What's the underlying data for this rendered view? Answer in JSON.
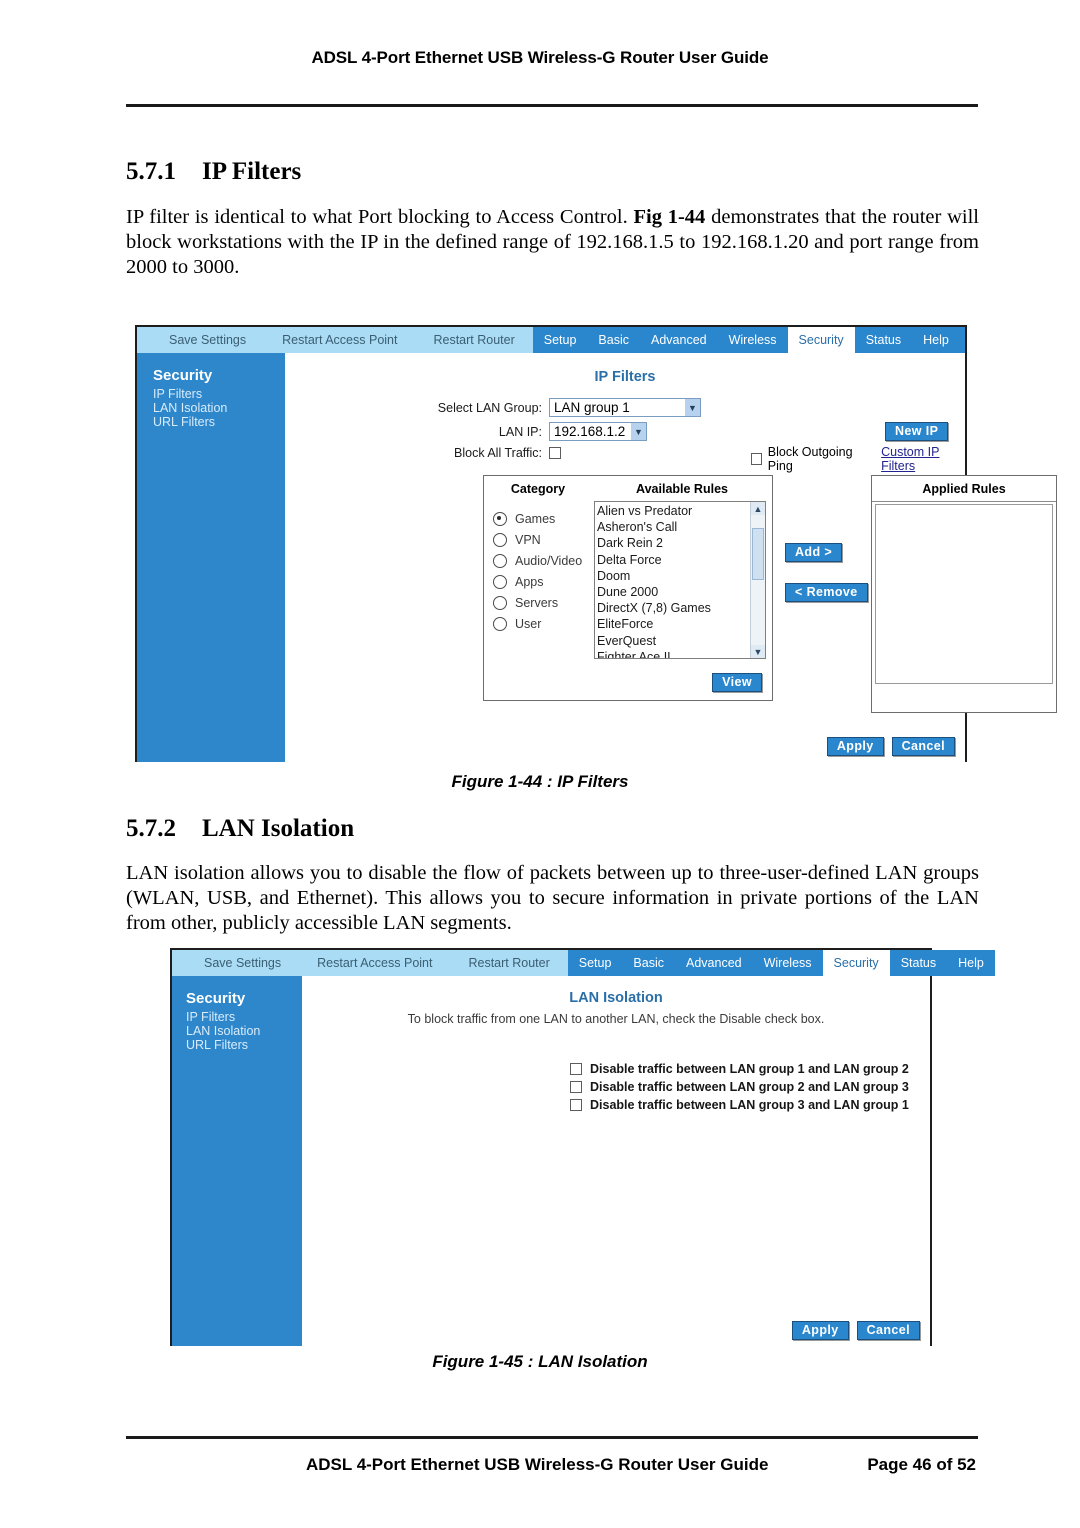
{
  "document": {
    "header_title": "ADSL 4-Port Ethernet USB Wireless-G Router User Guide",
    "footer_title": "ADSL 4-Port Ethernet USB Wireless-G Router User Guide",
    "footer_page": "Page 46 of 52"
  },
  "sections": {
    "ip_filters": {
      "number": "5.7.1",
      "title": "IP Filters",
      "paragraph": "IP filter is identical to what Port blocking to Access Control. Fig 1-44 demonstrates that the router will block workstations with the IP in the defined range of 192.168.1.5 to 192.168.1.20 and port range from 2000 to 3000.",
      "paragraph_html": "IP filter is identical to what Port blocking to Access Control. <b>Fig 1-44</b> demonstrates that the router will block workstations with the IP in the defined range of 192.168.1.5 to 192.168.1.20 and port range from 2000 to 3000.",
      "figure_caption": "Figure 1-44 : IP Filters"
    },
    "lan_isolation": {
      "number": "5.7.2",
      "title": "LAN Isolation",
      "paragraph": "LAN isolation allows you to disable the flow of packets between up to three-user-defined LAN groups (WLAN, USB, and Ethernet). This allows you to secure information in private portions of the LAN from other, publicly accessible LAN segments.",
      "figure_caption": "Figure 1-45 : LAN Isolation"
    }
  },
  "router_ui": {
    "nav_left": [
      "Save Settings",
      "Restart Access Point",
      "Restart Router"
    ],
    "nav_tabs": [
      {
        "label": "Setup",
        "active": false
      },
      {
        "label": "Basic",
        "active": false
      },
      {
        "label": "Advanced",
        "active": false
      },
      {
        "label": "Wireless",
        "active": false
      },
      {
        "label": "Security",
        "active": true
      },
      {
        "label": "Status",
        "active": false
      },
      {
        "label": "Help",
        "active": false
      }
    ],
    "sidebar": {
      "title": "Security",
      "links": [
        "IP Filters",
        "LAN Isolation",
        "URL Filters"
      ]
    },
    "colors": {
      "nav_light": "#aadcf5",
      "nav_dark": "#2a86cd",
      "sidebar": "#2e86cb",
      "title_blue": "#2a6fa8",
      "link_blue": "#23238e",
      "button_blue": "#2a86cd"
    }
  },
  "fig_ip_filters": {
    "page_title": "IP Filters",
    "labels": {
      "select_lan_group": "Select LAN Group:",
      "lan_ip": "LAN IP:",
      "block_all_traffic": "Block All Traffic:",
      "block_outgoing_ping": "Block Outgoing Ping",
      "custom_ip_filters": "Custom IP Filters"
    },
    "values": {
      "select_lan_group": "LAN group 1",
      "lan_ip": "192.168.1.2",
      "block_all_traffic_checked": false,
      "block_outgoing_ping_checked": false
    },
    "buttons": {
      "new_ip": "New IP",
      "add": "Add >",
      "remove": "< Remove",
      "view": "View",
      "apply": "Apply",
      "cancel": "Cancel"
    },
    "panels": {
      "category_header": "Category",
      "available_rules_header": "Available Rules",
      "applied_rules_header": "Applied Rules"
    },
    "categories": [
      {
        "label": "Games",
        "selected": true
      },
      {
        "label": "VPN",
        "selected": false
      },
      {
        "label": "Audio/Video",
        "selected": false
      },
      {
        "label": "Apps",
        "selected": false
      },
      {
        "label": "Servers",
        "selected": false
      },
      {
        "label": "User",
        "selected": false
      }
    ],
    "available_rules": [
      "Alien vs Predator",
      "Asheron's Call",
      "Dark Rein 2",
      "Delta Force",
      "Doom",
      "Dune 2000",
      "DirectX (7,8) Games",
      "EliteForce",
      "EverQuest",
      "Fighter Ace II"
    ],
    "applied_rules": [],
    "scroll_icons": {
      "up": "▲",
      "down": "▼"
    },
    "dropdown_icon": "▼"
  },
  "fig_lan_isolation": {
    "page_title": "LAN Isolation",
    "instruction": "To block traffic from one LAN to another LAN, check the Disable check box.",
    "checkboxes": [
      {
        "label": "Disable traffic between LAN group 1 and LAN group 2",
        "checked": false
      },
      {
        "label": "Disable traffic between LAN group 2 and LAN group 3",
        "checked": false
      },
      {
        "label": "Disable traffic between LAN group 3 and LAN group 1",
        "checked": false
      }
    ],
    "buttons": {
      "apply": "Apply",
      "cancel": "Cancel"
    }
  }
}
